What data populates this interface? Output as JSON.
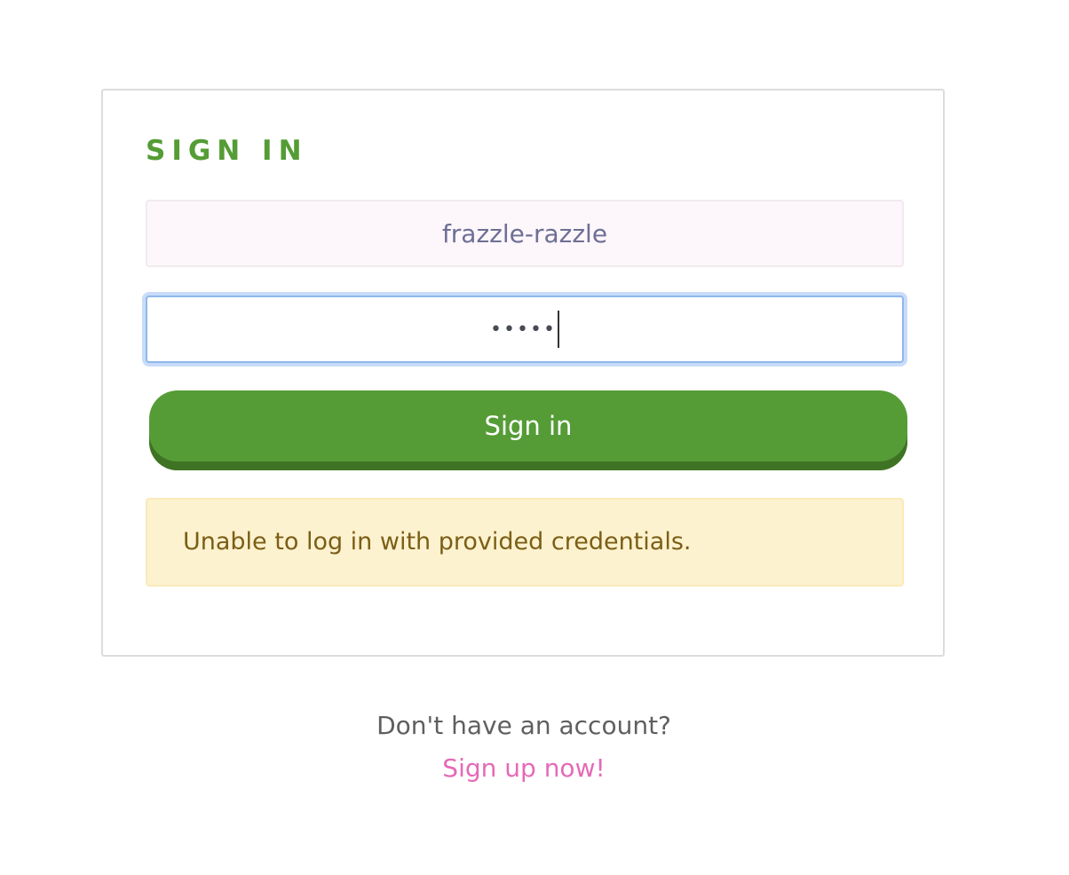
{
  "form": {
    "title": "SIGN IN",
    "username_value": "frazzle-razzle",
    "password_mask": "•••••",
    "submit_label": "Sign in",
    "error_message": "Unable to log in with provided credentials."
  },
  "footer": {
    "prompt": "Don't have an account?",
    "signup_link": "Sign up now!"
  },
  "colors": {
    "brand_green": "#559c36",
    "button_shadow": "#3f7324",
    "link_pink": "#e669b7",
    "alert_bg": "#fdf2cf",
    "alert_text": "#7b5e16",
    "focus_ring": "#8fb8ec"
  }
}
